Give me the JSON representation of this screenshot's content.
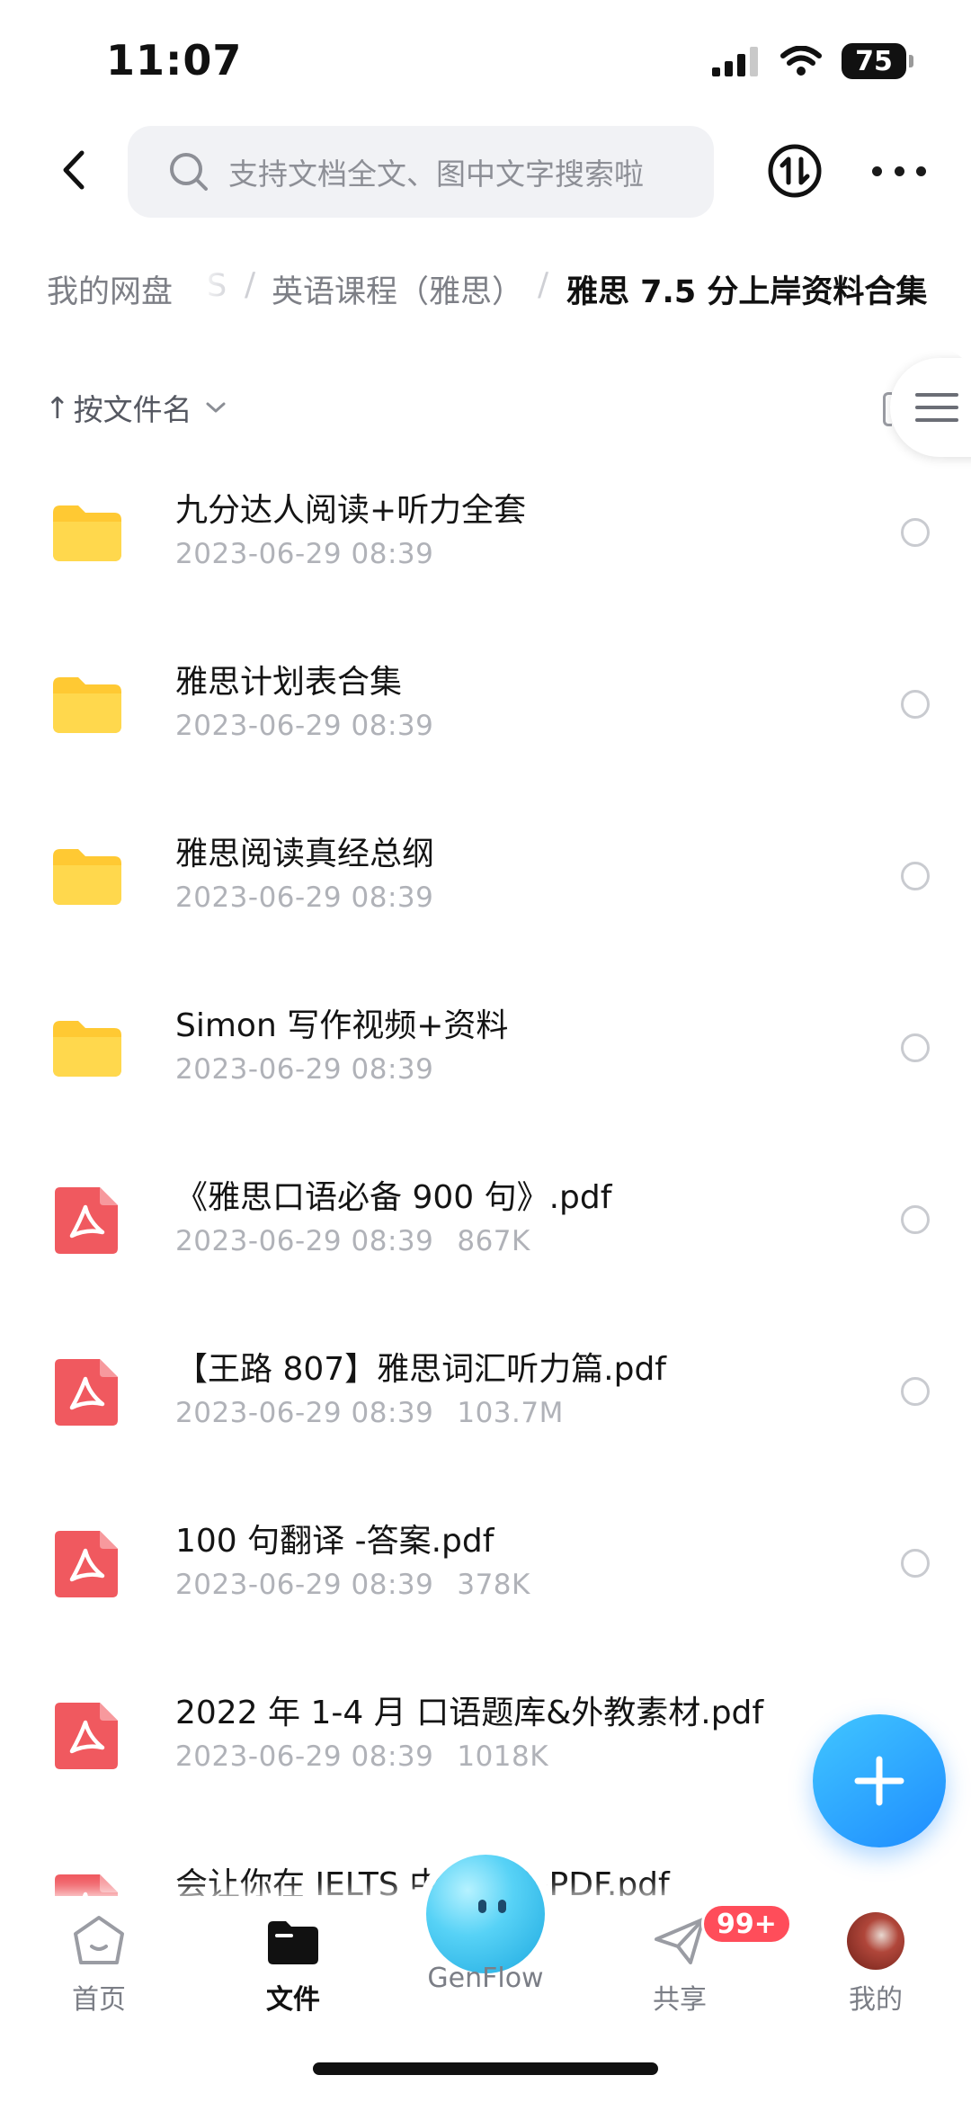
{
  "status_bar": {
    "time": "11:07",
    "battery": "75"
  },
  "header": {
    "search_placeholder": "支持文档全文、图中文字搜索啦"
  },
  "breadcrumb": {
    "root": "我的网盘",
    "faded": "S",
    "separator": "/",
    "middle": "英语课程（雅思）",
    "current": "雅思 7.5 分上岸资料合集"
  },
  "sort": {
    "arrow": "↑",
    "label": "按文件名"
  },
  "files": [
    {
      "name": "九分达人阅读+听力全套",
      "date": "2023-06-29 08:39",
      "size": "",
      "type": "folder"
    },
    {
      "name": "雅思计划表合集",
      "date": "2023-06-29 08:39",
      "size": "",
      "type": "folder"
    },
    {
      "name": "雅思阅读真经总纲",
      "date": "2023-06-29 08:39",
      "size": "",
      "type": "folder"
    },
    {
      "name": "Simon 写作视频+资料",
      "date": "2023-06-29 08:39",
      "size": "",
      "type": "folder"
    },
    {
      "name": "《雅思口语必备 900 句》.pdf",
      "date": "2023-06-29 08:39",
      "size": "867K",
      "type": "pdf"
    },
    {
      "name": "【王路 807】雅思词汇听力篇.pdf",
      "date": "2023-06-29 08:39",
      "size": "103.7M",
      "type": "pdf"
    },
    {
      "name": "100 句翻译 -答案.pdf",
      "date": "2023-06-29 08:39",
      "size": "378K",
      "type": "pdf"
    },
    {
      "name": "2022 年 1-4 月 口语题库&外教素材.pdf",
      "date": "2023-06-29 08:39",
      "size": "1018K",
      "type": "pdf"
    },
    {
      "name": "会让你在 IELTS 中…0 条-PDF.pdf",
      "date": "",
      "size": "",
      "type": "pdf"
    }
  ],
  "tabs": {
    "home": "首页",
    "files": "文件",
    "genflow": "GenFlow",
    "share": "共享",
    "share_badge": "99+",
    "me": "我的"
  },
  "colors": {
    "accent": "#1e8cff",
    "folder": "#ffc933",
    "pdf": "#f0595f",
    "badge": "#ff4d5a"
  }
}
